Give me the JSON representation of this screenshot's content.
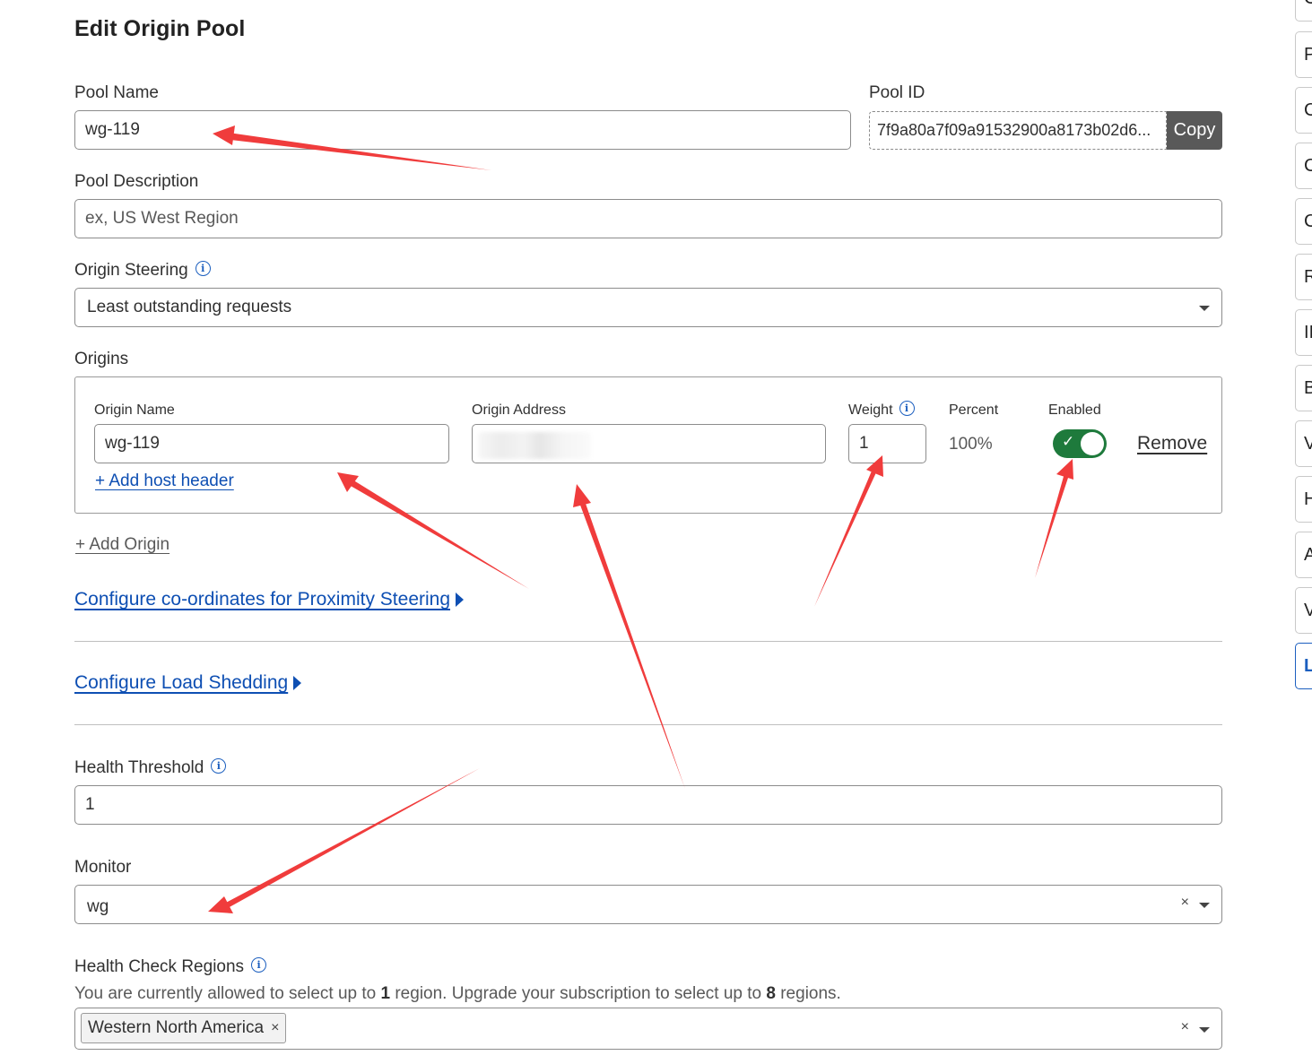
{
  "page": {
    "title": "Edit Origin Pool"
  },
  "pool_name": {
    "label": "Pool Name",
    "value": "wg-119"
  },
  "pool_id": {
    "label": "Pool ID",
    "value": "7f9a80a7f09a91532900a8173b02d6...",
    "copy_label": "Copy"
  },
  "pool_description": {
    "label": "Pool Description",
    "placeholder": "ex, US West Region"
  },
  "origin_steering": {
    "label": "Origin Steering",
    "value": "Least outstanding requests"
  },
  "origins": {
    "label": "Origins",
    "columns": {
      "name": "Origin Name",
      "address": "Origin Address",
      "weight": "Weight",
      "percent": "Percent",
      "enabled": "Enabled"
    },
    "row": {
      "name": "wg-119",
      "address": "",
      "weight": "1",
      "percent": "100%",
      "enabled": true,
      "remove_label": "Remove",
      "add_host_header": "+ Add host header"
    },
    "add_origin": "+ Add Origin"
  },
  "proximity": {
    "label": "Configure co-ordinates for Proximity Steering"
  },
  "load_shedding": {
    "label": "Configure Load Shedding"
  },
  "health_threshold": {
    "label": "Health Threshold",
    "value": "1"
  },
  "monitor": {
    "label": "Monitor",
    "value": "wg"
  },
  "health_check_regions": {
    "label": "Health Check Regions",
    "note_a": "You are currently allowed to select up to ",
    "note_b": "1",
    "note_c": " region. Upgrade your subscription to select up to ",
    "note_d": "8",
    "note_e": " regions.",
    "selected": "Western North America"
  },
  "sidebar": {
    "tabs": [
      "C",
      "P",
      "C",
      "C",
      "C",
      "R",
      "II",
      "B",
      "V",
      "H",
      "A",
      "V",
      "L"
    ]
  },
  "colors": {
    "accent": "#1c5fbf",
    "link": "#0e4fb3",
    "toggle_on": "#1e7a3c",
    "annotation": "#f03c3c"
  }
}
